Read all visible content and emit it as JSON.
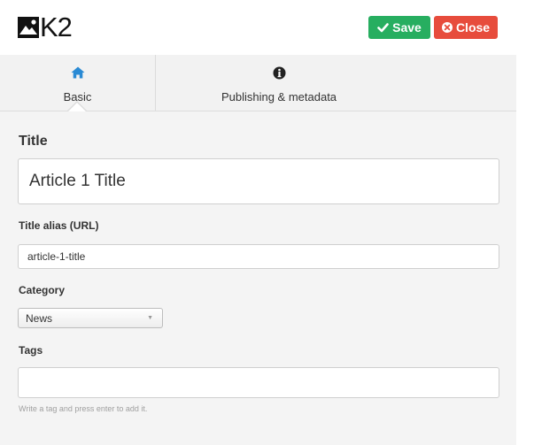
{
  "app": {
    "logo_text": "K2"
  },
  "toolbar": {
    "save_label": "Save",
    "close_label": "Close"
  },
  "tabs": [
    {
      "label": "Basic",
      "icon": "home-icon",
      "active": true
    },
    {
      "label": "Publishing & metadata",
      "icon": "info-icon",
      "active": false
    }
  ],
  "form": {
    "title_label": "Title",
    "title_value": "Article 1 Title",
    "alias_label": "Title alias (URL)",
    "alias_value": "article-1-title",
    "category_label": "Category",
    "category_value": "News",
    "tags_label": "Tags",
    "tags_value": "",
    "tags_hint": "Write a tag and press enter to add it."
  },
  "colors": {
    "save": "#27ae60",
    "close": "#e74c3c",
    "tab_icon": "#2a8ad4"
  }
}
